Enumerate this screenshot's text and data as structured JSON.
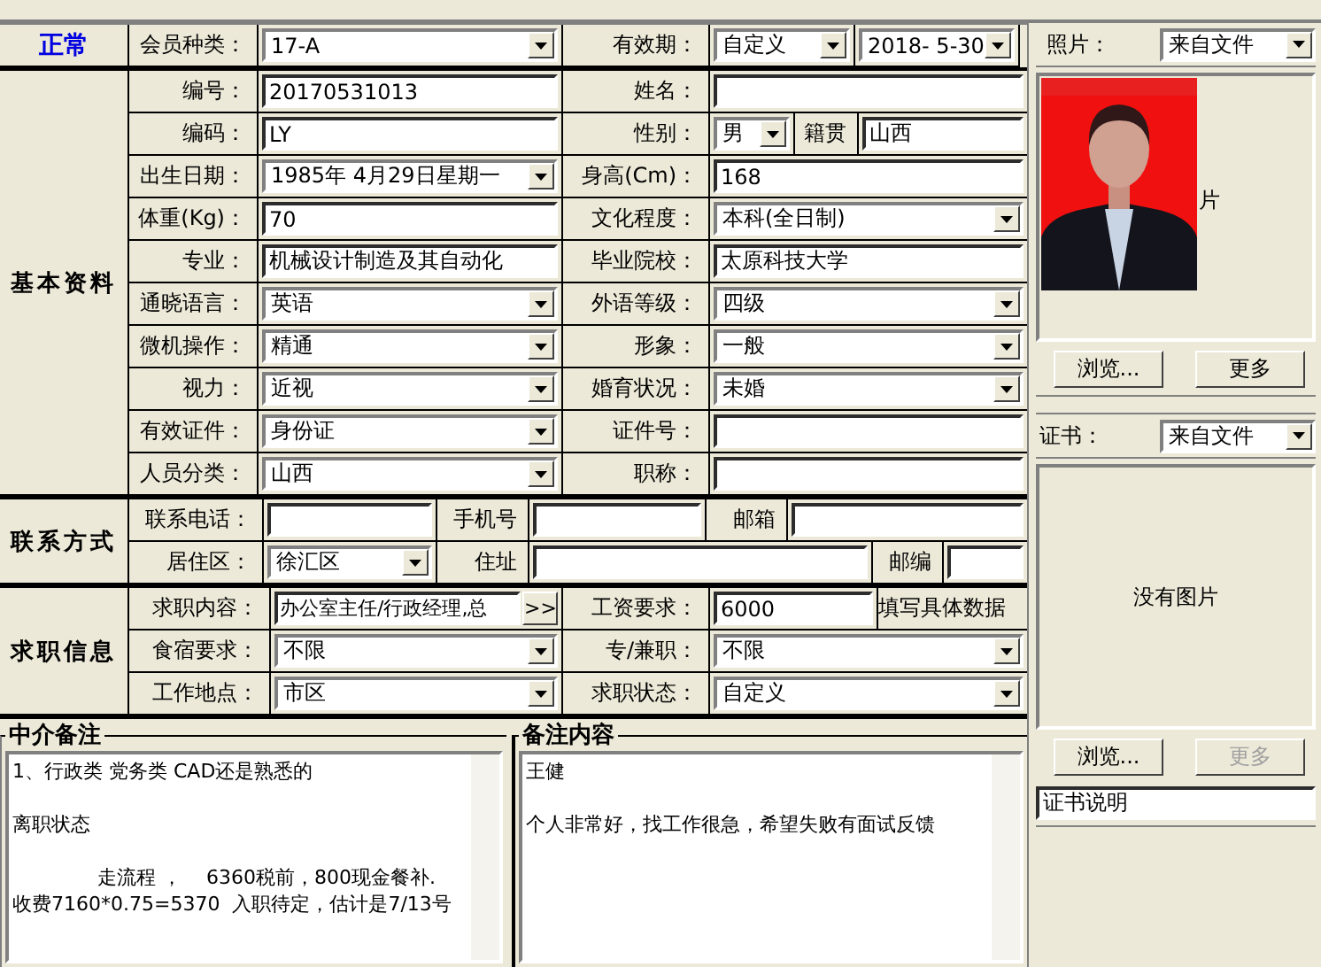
{
  "status": "正常",
  "header_row": [
    {
      "kind": "label",
      "text": "会员种类："
    },
    {
      "kind": "combo",
      "value": "17-A"
    },
    {
      "kind": "label",
      "text": "有效期："
    },
    {
      "kind": "combo",
      "value": "自定义"
    },
    {
      "kind": "combo",
      "value": "2018- 5-30"
    }
  ],
  "sections": [
    {
      "title": "基本资料",
      "rows": [
        [
          {
            "kind": "label",
            "text": "编号："
          },
          {
            "kind": "text",
            "value": "20170531013"
          },
          {
            "kind": "label",
            "text": "姓名："
          },
          {
            "kind": "text"
          }
        ],
        [
          {
            "kind": "label",
            "text": "编码："
          },
          {
            "kind": "text",
            "value": "LY"
          },
          {
            "kind": "label",
            "text": "性别："
          },
          {
            "kind": "combo",
            "value": "男"
          },
          {
            "kind": "label",
            "text": "籍贯"
          },
          {
            "kind": "text",
            "value": "山西"
          }
        ],
        [
          {
            "kind": "label",
            "text": "出生日期："
          },
          {
            "kind": "combo",
            "value": "1985年 4月29日星期一"
          },
          {
            "kind": "label",
            "text": "身高(Cm)："
          },
          {
            "kind": "text",
            "value": "168"
          }
        ],
        [
          {
            "kind": "label",
            "text": "体重(Kg)："
          },
          {
            "kind": "text",
            "value": "70"
          },
          {
            "kind": "label",
            "text": "文化程度："
          },
          {
            "kind": "combo",
            "value": "本科(全日制)"
          }
        ],
        [
          {
            "kind": "label",
            "text": "专业："
          },
          {
            "kind": "text",
            "value": "机械设计制造及其自动化"
          },
          {
            "kind": "label",
            "text": "毕业院校："
          },
          {
            "kind": "text",
            "value": "太原科技大学"
          }
        ],
        [
          {
            "kind": "label",
            "text": "通晓语言："
          },
          {
            "kind": "combo",
            "value": "英语"
          },
          {
            "kind": "label",
            "text": "外语等级："
          },
          {
            "kind": "combo",
            "value": "四级"
          }
        ],
        [
          {
            "kind": "label",
            "text": "微机操作："
          },
          {
            "kind": "combo",
            "value": "精通"
          },
          {
            "kind": "label",
            "text": "形象："
          },
          {
            "kind": "combo",
            "value": "一般"
          }
        ],
        [
          {
            "kind": "label",
            "text": "视力："
          },
          {
            "kind": "combo",
            "value": "近视"
          },
          {
            "kind": "label",
            "text": "婚育状况："
          },
          {
            "kind": "combo",
            "value": "未婚"
          }
        ],
        [
          {
            "kind": "label",
            "text": "有效证件："
          },
          {
            "kind": "combo",
            "value": "身份证"
          },
          {
            "kind": "label",
            "text": "证件号："
          },
          {
            "kind": "text"
          }
        ],
        [
          {
            "kind": "label",
            "text": "人员分类："
          },
          {
            "kind": "combo",
            "value": "山西"
          },
          {
            "kind": "label",
            "text": "职称："
          },
          {
            "kind": "text"
          }
        ]
      ]
    },
    {
      "title": "联系方式",
      "rows": [
        [
          {
            "kind": "label",
            "text": "联系电话："
          },
          {
            "kind": "text"
          },
          {
            "kind": "label",
            "text": "手机号"
          },
          {
            "kind": "text"
          },
          {
            "kind": "label",
            "text": "邮箱"
          },
          {
            "kind": "text"
          }
        ],
        [
          {
            "kind": "label",
            "text": "居住区："
          },
          {
            "kind": "combo",
            "value": "徐汇区"
          },
          {
            "kind": "label",
            "text": "住址"
          },
          {
            "kind": "text"
          },
          {
            "kind": "label",
            "text": "邮编"
          },
          {
            "kind": "text"
          }
        ]
      ]
    },
    {
      "title": "求职信息",
      "rows": [
        [
          {
            "kind": "label",
            "text": "求职内容："
          },
          {
            "kind": "more",
            "value": "办公室主任/行政经理,总",
            "button": ">>"
          },
          {
            "kind": "label",
            "text": "工资要求："
          },
          {
            "kind": "text",
            "value": "6000"
          },
          {
            "kind": "note",
            "text": "填写具体数据"
          }
        ],
        [
          {
            "kind": "label",
            "text": "食宿要求："
          },
          {
            "kind": "combo",
            "value": "不限"
          },
          {
            "kind": "label",
            "text": "专/兼职："
          },
          {
            "kind": "combo",
            "value": "不限"
          }
        ],
        [
          {
            "kind": "label",
            "text": "工作地点："
          },
          {
            "kind": "combo",
            "value": "市区"
          },
          {
            "kind": "label",
            "text": "求职状态："
          },
          {
            "kind": "combo",
            "value": "自定义"
          }
        ]
      ]
    }
  ],
  "notes": [
    {
      "title": "中介备注",
      "paragraphs": [
        [
          "1、行政类 党务类 CAD还是熟悉的"
        ],
        [
          "离职状态"
        ],
        [
          "走流程 ，    6360税前，800现金餐补.",
          "收费7160*0.75=5370  入职待定，估计是7/13号"
        ]
      ]
    },
    {
      "title": "备注内容",
      "paragraphs": [
        [
          "王健"
        ],
        [
          "个人非常好，找工作很急，希望失败有面试反馈"
        ]
      ]
    }
  ],
  "photo": {
    "label": "照片：",
    "source": "来自文件",
    "caption": "片",
    "buttons": [
      {
        "label": "浏览...",
        "disabled": false
      },
      {
        "label": "更多",
        "disabled": false
      }
    ]
  },
  "certificate": {
    "label": "证书：",
    "source": "来自文件",
    "empty_text": "没有图片",
    "buttons": [
      {
        "label": "浏览...",
        "disabled": false
      },
      {
        "label": "更多",
        "disabled": true
      }
    ],
    "description": "证书说明"
  }
}
